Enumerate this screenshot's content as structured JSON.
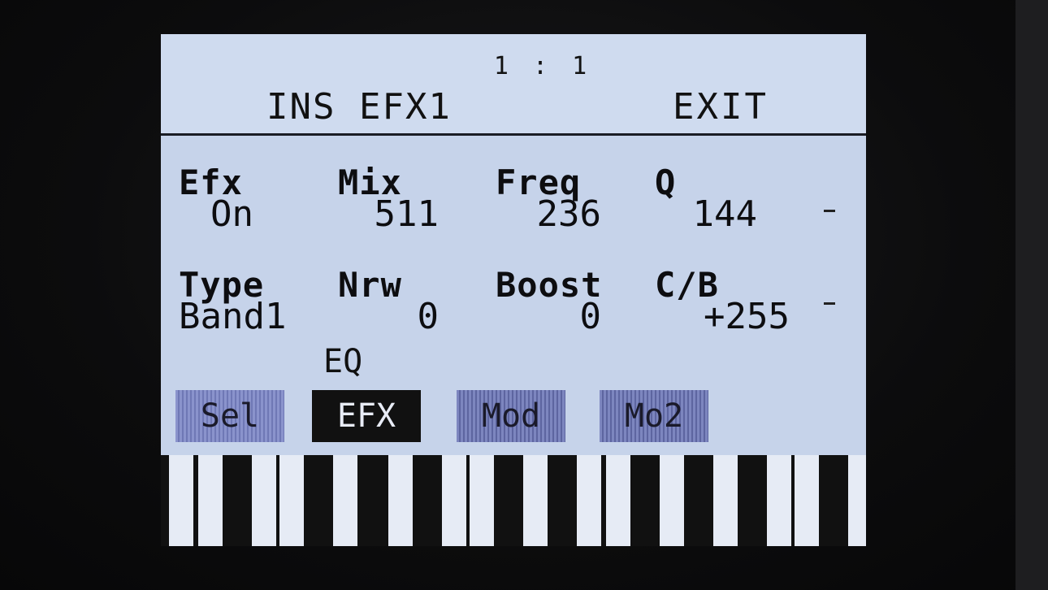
{
  "header": {
    "position": "1 : 1",
    "title": "INS EFX1",
    "exit_label": "EXIT"
  },
  "row1": [
    {
      "label": "Efx",
      "value": "On"
    },
    {
      "label": "Mix",
      "value": "511"
    },
    {
      "label": "Freq",
      "value": "236"
    },
    {
      "label": "Q",
      "value": "144"
    }
  ],
  "row2": [
    {
      "label": "Type",
      "value": "Band1"
    },
    {
      "label": "Nrw",
      "value": "0"
    },
    {
      "label": "Boost",
      "value": "0"
    },
    {
      "label": "C/B",
      "value": "+255"
    }
  ],
  "effect_name": "EQ",
  "tabs": [
    {
      "label": "Sel",
      "active": false
    },
    {
      "label": "EFX",
      "active": true
    },
    {
      "label": "Mod",
      "active": false
    },
    {
      "label": "Mo2",
      "active": false
    }
  ],
  "colors": {
    "screen_bg": "#c6d3ea",
    "active_tab_bg": "#111111",
    "inactive_tab_bg": "#6f78b5"
  }
}
